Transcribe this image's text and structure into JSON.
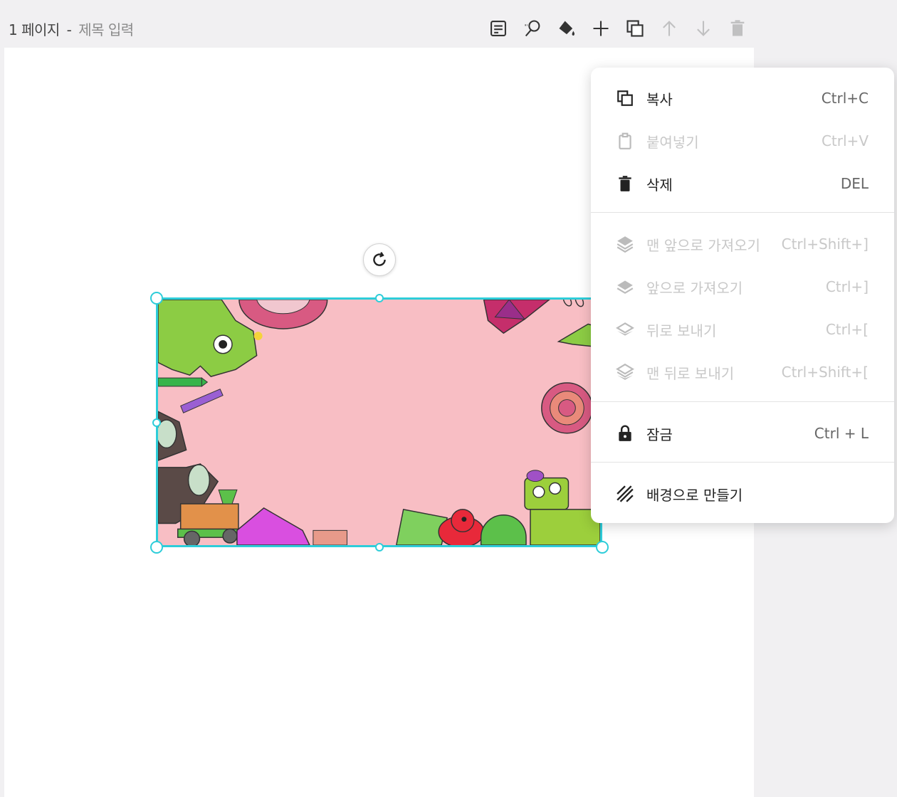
{
  "header": {
    "page_number": "1 페이지",
    "separator": "-",
    "title_placeholder": "제목 입력"
  },
  "toolbar": {
    "buttons": [
      {
        "icon": "memo-icon",
        "enabled": true
      },
      {
        "icon": "magic-select-icon",
        "enabled": true
      },
      {
        "icon": "paint-bucket-icon",
        "enabled": true
      },
      {
        "icon": "add-icon",
        "enabled": true
      },
      {
        "icon": "duplicate-icon",
        "enabled": true
      },
      {
        "icon": "arrow-up-icon",
        "enabled": false
      },
      {
        "icon": "arrow-down-icon",
        "enabled": false
      },
      {
        "icon": "trash-icon",
        "enabled": false
      }
    ]
  },
  "context_menu": {
    "items": [
      {
        "label": "복사",
        "shortcut": "Ctrl+C",
        "icon": "copy-icon",
        "enabled": true
      },
      {
        "label": "붙여넣기",
        "shortcut": "Ctrl+V",
        "icon": "clipboard-icon",
        "enabled": false
      },
      {
        "label": "삭제",
        "shortcut": "DEL",
        "icon": "trash-icon",
        "enabled": true
      },
      {
        "label": "맨 앞으로 가져오기",
        "shortcut": "Ctrl+Shift+]",
        "icon": "layers-front-icon",
        "enabled": false
      },
      {
        "label": "앞으로 가져오기",
        "shortcut": "Ctrl+]",
        "icon": "layer-forward-icon",
        "enabled": false
      },
      {
        "label": "뒤로 보내기",
        "shortcut": "Ctrl+[",
        "icon": "layer-backward-icon",
        "enabled": false
      },
      {
        "label": "맨 뒤로 보내기",
        "shortcut": "Ctrl+Shift+[",
        "icon": "layers-back-icon",
        "enabled": false
      },
      {
        "label": "잠금",
        "shortcut": "Ctrl + L",
        "icon": "lock-icon",
        "enabled": true
      },
      {
        "label": "배경으로 만들기",
        "shortcut": "",
        "icon": "background-hatch-icon",
        "enabled": true
      }
    ]
  },
  "colors": {
    "selection": "#2ecdd9",
    "image_background": "#f8bec4"
  }
}
